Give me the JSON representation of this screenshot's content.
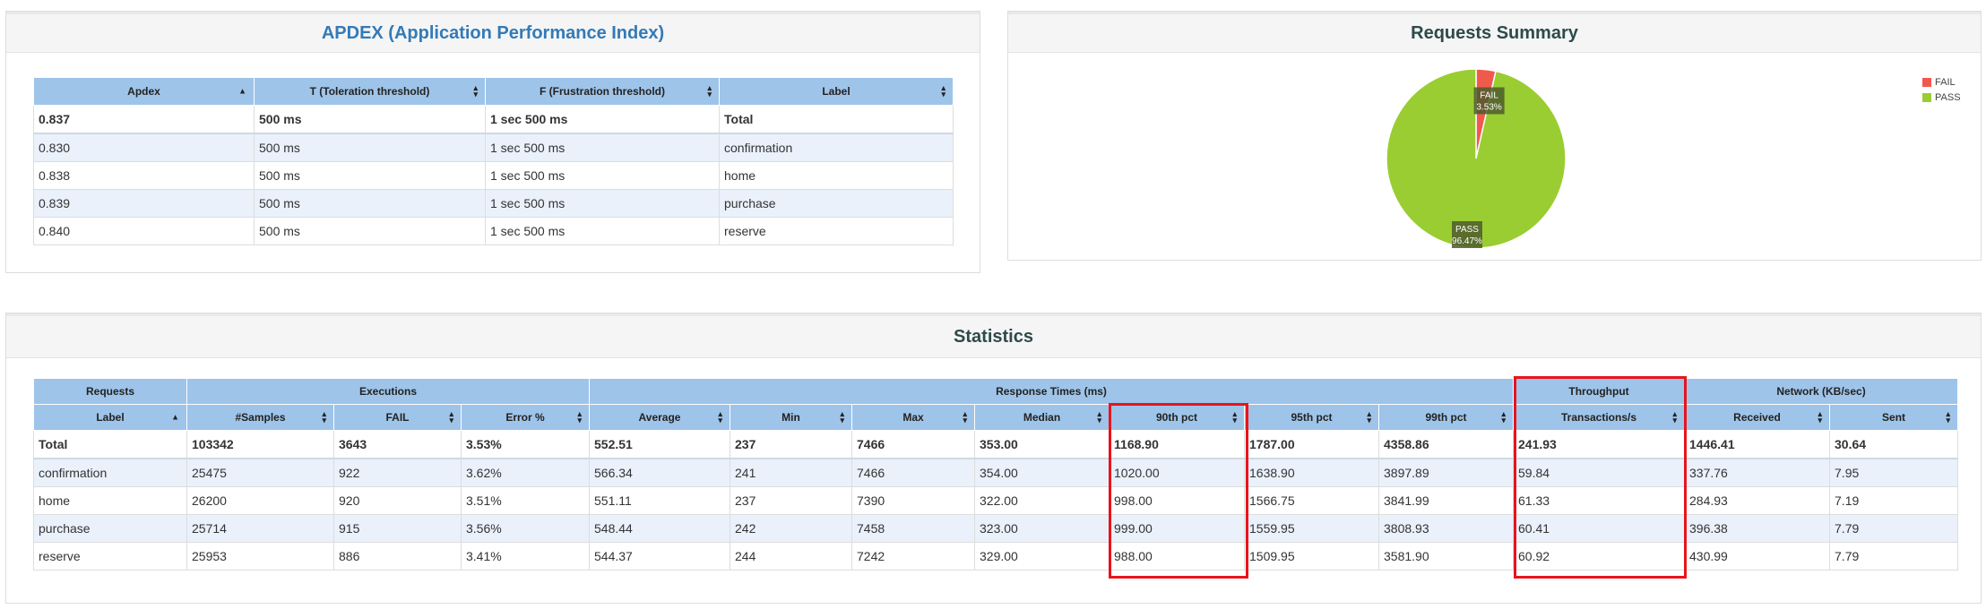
{
  "apdex": {
    "title": "APDEX (Application Performance Index)",
    "headers": [
      "Apdex",
      "T (Toleration threshold)",
      "F (Frustration threshold)",
      "Label"
    ],
    "rows": [
      [
        "0.837",
        "500 ms",
        "1 sec 500 ms",
        "Total"
      ],
      [
        "0.830",
        "500 ms",
        "1 sec 500 ms",
        "confirmation"
      ],
      [
        "0.838",
        "500 ms",
        "1 sec 500 ms",
        "home"
      ],
      [
        "0.839",
        "500 ms",
        "1 sec 500 ms",
        "purchase"
      ],
      [
        "0.840",
        "500 ms",
        "1 sec 500 ms",
        "reserve"
      ]
    ]
  },
  "summary": {
    "title": "Requests Summary",
    "legend": [
      "FAIL",
      "PASS"
    ],
    "colors": {
      "FAIL": "#f05a4d",
      "PASS": "#9acd32"
    },
    "fail_label": "FAIL",
    "fail_pct": "3.53%",
    "pass_label": "PASS",
    "pass_pct": "96.47%"
  },
  "chart_data": {
    "type": "pie",
    "title": "Requests Summary",
    "labels": [
      "FAIL",
      "PASS"
    ],
    "values": [
      3.53,
      96.47
    ],
    "legend_position": "top-right"
  },
  "stats": {
    "title": "Statistics",
    "groups": [
      "Requests",
      "Executions",
      "Response Times (ms)",
      "Throughput",
      "Network (KB/sec)"
    ],
    "headers": [
      "Label",
      "#Samples",
      "FAIL",
      "Error %",
      "Average",
      "Min",
      "Max",
      "Median",
      "90th pct",
      "95th pct",
      "99th pct",
      "Transactions/s",
      "Received",
      "Sent"
    ],
    "rows": [
      [
        "Total",
        "103342",
        "3643",
        "3.53%",
        "552.51",
        "237",
        "7466",
        "353.00",
        "1168.90",
        "1787.00",
        "4358.86",
        "241.93",
        "1446.41",
        "30.64"
      ],
      [
        "confirmation",
        "25475",
        "922",
        "3.62%",
        "566.34",
        "241",
        "7466",
        "354.00",
        "1020.00",
        "1638.90",
        "3897.89",
        "59.84",
        "337.76",
        "7.95"
      ],
      [
        "home",
        "26200",
        "920",
        "3.51%",
        "551.11",
        "237",
        "7390",
        "322.00",
        "998.00",
        "1566.75",
        "3841.99",
        "61.33",
        "284.93",
        "7.19"
      ],
      [
        "purchase",
        "25714",
        "915",
        "3.56%",
        "548.44",
        "242",
        "7458",
        "323.00",
        "999.00",
        "1559.95",
        "3808.93",
        "60.41",
        "396.38",
        "7.79"
      ],
      [
        "reserve",
        "25953",
        "886",
        "3.41%",
        "544.37",
        "244",
        "7242",
        "329.00",
        "988.00",
        "1509.95",
        "3581.90",
        "60.92",
        "430.99",
        "7.79"
      ]
    ]
  }
}
